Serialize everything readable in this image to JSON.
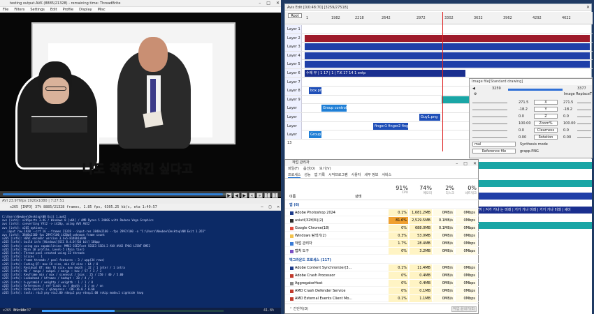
{
  "player": {
    "title": "testing output.AVK (8885/21328) - remaining time: ThreadBrite",
    "menu": [
      "File",
      "Filters",
      "Settings",
      "Edit",
      "Profile",
      "Display",
      "Misc"
    ],
    "subtitle": "나도 착취하긴 싶다고",
    "status": "AVI 23.976fps 1920x1080 | 7:27:51"
  },
  "console": {
    "title": "x265 [INFO] 37% 8885/21328 frames, 1.85 fps, 6305.25 kb/s, eta 1:49:57",
    "lines": [
      "C:\\Users\\Newbee\\Desktop\\NN Exit 1.aw42",
      "",
      "avs [info]: x265ports 3.4G / Windows 8 [x64] / AMD Ryzen 5 2400G with Radeon Vega Graphics",
      "avs [info]: converting YV12 -> i420p, using AVX AVX2",
      "avs [info]: x265 options...",
      "...input raw 1920 --crf 16 --frames 21328 --input-res 3840x2160 --fps 2997/100 -o \"C:\\Users\\Newbee\\Desktop\\NN Exit 1.265\"",
      "",
      "avs [info]: 3840x2160 fps 2997/100 i420p8 unknown frame count",
      "x265 [info]: HEVC encoder version 3.4+5-8146b1a848",
      "x265 [info]: build info [Windows][GCC 8.4.0][64 bit] 10bpp",
      "x265 [info]: using cpu capabilities: MMX2 SSE2Fast SSSE3 SSE4.2 AVX AVX2 FMA3 LZCNT BMI2",
      "x265 [info]: Main 10 profile, Level-5 (Main tier)",
      "x265 [info]: Thread pool created using 12 threads",
      "x265 [info]: Slices  : 1",
      "x265 [info]: frame threads / pool features : 3 / wpp(34 rows)",
      "x265 [info]: Coding QT: max CU size, min CU size : 64 / 8",
      "x265 [info]: Residual QT: max TU size, max depth : 32 / 1 inter / 1 intra",
      "x265 [info]: ME / range / subpel / merge : hex / 57 / 2 / 3",
      "x265 [info]: Keyframe min / max / scenecut / bias : 25 / 250 / 40 / 5.00",
      "x265 [info]: Lookahead / bframes / badapt : 20 / 4 / 2",
      "x265 [info]: b-pyramid / weightp / weightb : 1 / 1 / 0",
      "x265 [info]: References / ref-limit cu / depth : 3 / on / on",
      "x265 [info]: Rate Control / qCompress : CRF-16.0 / 0.60",
      "x265 [info]: tools: rd=3 psy-rd=2.00 rdoq=2 psy-rdoq=1.00 rskip mode=1 signhide tmvp"
    ],
    "footer_left": "x265 Encode",
    "footer_time": "01:18:07",
    "footer_pct": "41.8%"
  },
  "timeline": {
    "title": "Avis Edit [0/0:48:70] [3259/27518]",
    "root": "Root",
    "ruler": [
      "1",
      "1982",
      "2218",
      "2642",
      "2972",
      "3302",
      "3632",
      "3962",
      "4292",
      "4622"
    ],
    "layers": [
      "Layer 1",
      "Layer 2",
      "Layer 3",
      "Layer 4",
      "Layer 5",
      "Layer 6",
      "Layer 7",
      "Layer 8",
      "Layer 9",
      "Layer 10",
      "Layer 11",
      "Layer 12",
      "Layer 13"
    ],
    "clips": [
      {
        "layer": 1,
        "label": "",
        "color": "#9e1b2b"
      },
      {
        "layer": 2,
        "label": "",
        "color": "#1f3fa8"
      },
      {
        "layer": 3,
        "label": "",
        "color": "#1f3fa8"
      },
      {
        "layer": 4,
        "label": "",
        "color": "#1f3fa8"
      },
      {
        "layer": 5,
        "label": "수에 부 | 1 17 | 1 | T.K 17 14 1 entp",
        "color": "#1a2f8f"
      },
      {
        "layer": 7,
        "label": "box.png",
        "color": "#1f4fb8"
      },
      {
        "layer": 8,
        "label": "",
        "color": "#1aa6a6"
      },
      {
        "layer": 9,
        "label": "Group control",
        "color": "#1f7fd6"
      },
      {
        "layer": 10,
        "label": "Guy1.png",
        "color": "#1f4fb8"
      },
      {
        "layer": 11,
        "label": "finger1 finger2 finger2",
        "color": "#1f4fb8"
      },
      {
        "layer": 12,
        "label": "Group",
        "color": "#1f7fd6"
      }
    ]
  },
  "dialog": {
    "title": "Image file[Standard drawing]",
    "frame_start": "3259",
    "frame_end": "3377",
    "right_label": "Image ReplaceT",
    "rows": [
      {
        "left": "271.5",
        "label": "X",
        "right": "271.5"
      },
      {
        "left": "-18.2",
        "label": "Y",
        "right": "-18.2"
      },
      {
        "left": "0.0",
        "label": "Z",
        "right": "0.0"
      },
      {
        "left": "100.00",
        "label": "Zoom%",
        "right": "100.00"
      },
      {
        "left": "0.0",
        "label": "Clearness",
        "right": "0.0"
      },
      {
        "left": "0.00",
        "label": "Rotation",
        "right": "0.00"
      }
    ],
    "blend_label": "Synthesis mode",
    "blend_value": "mal",
    "ref_button": "Reference file",
    "ref_value": "grapp.PNG"
  },
  "taskmgr": {
    "title": "작업 관리자",
    "menu": [
      "파일(F)",
      "옵션(O)",
      "보기(V)"
    ],
    "tabs": [
      "프로세스",
      "성능",
      "앱 기록",
      "시작프로그램",
      "사용자",
      "세부 정보",
      "서비스"
    ],
    "headers": {
      "name": "이름",
      "status": "상태",
      "cpu_pct": "91%",
      "cpu": "CPU",
      "mem_pct": "74%",
      "mem": "메모리",
      "disk_pct": "2%",
      "disk": "디스크",
      "net_pct": "0%",
      "net": "네트워크"
    },
    "apps_group": "앱 (6)",
    "bg_group": "백그라운드 프로세스 (117)",
    "apps": [
      {
        "name": "Adobe Photoshop 2024",
        "cpu": "0.1%",
        "mem": "1,681.2MB",
        "disk": "0MB/s",
        "net": "0Mbps",
        "icon": "#1d3b8a"
      },
      {
        "name": "aviutl(32비트)(2)",
        "cpu": "81.6%",
        "mem": "2,529.5MB",
        "disk": "0.1MB/s",
        "net": "0Mbps",
        "icon": "#2c2c2c"
      },
      {
        "name": "Google Chrome(18)",
        "cpu": "0%",
        "mem": "688.0MB",
        "disk": "0.1MB/s",
        "net": "0Mbps",
        "icon": "#e14a3b"
      },
      {
        "name": "Windows 탐색기(2)",
        "cpu": "0.3%",
        "mem": "53.0MB",
        "disk": "0MB/s",
        "net": "0Mbps",
        "icon": "#f2c24b"
      },
      {
        "name": "작업 관리자",
        "cpu": "1.7%",
        "mem": "28.4MB",
        "disk": "0MB/s",
        "net": "0Mbps",
        "icon": "#3a7bd5"
      },
      {
        "name": "캡처 도구",
        "cpu": "0%",
        "mem": "3.2MB",
        "disk": "0MB/s",
        "net": "0Mbps",
        "icon": "#7b4fc4"
      }
    ],
    "bg": [
      {
        "name": "Adobe Content Synchronizer(3...",
        "cpu": "0.1%",
        "mem": "11.4MB",
        "disk": "0MB/s",
        "net": "0Mbps",
        "icon": "#1d3b8a"
      },
      {
        "name": "Adobe Crash Processor",
        "cpu": "0%",
        "mem": "0.4MB",
        "disk": "0MB/s",
        "net": "0Mbps",
        "icon": "#c0392b"
      },
      {
        "name": "AggregatorHost",
        "cpu": "0%",
        "mem": "0.4MB",
        "disk": "0MB/s",
        "net": "0Mbps",
        "icon": "#888888"
      },
      {
        "name": "AMD Crash Defender Service",
        "cpu": "0%",
        "mem": "0.1MB",
        "disk": "0MB/s",
        "net": "0Mbps",
        "icon": "#c0392b"
      },
      {
        "name": "AMD External Events Client Mo...",
        "cpu": "0.1%",
        "mem": "1.1MB",
        "disk": "0MB/s",
        "net": "0Mbps",
        "icon": "#c0392b"
      }
    ],
    "footer": "간단히(D)",
    "end_task": "작업 끝내기(E)"
  },
  "side_strip": {
    "ticker": "까 | 겨가 가냐 는 미래 | 거거 가냐 미래 | 거거 가냐 미래 | 세이"
  },
  "colors": {
    "desktop": "#1f3a63",
    "console_bg": "#0c2a66",
    "accent": "#2e7fd6"
  }
}
